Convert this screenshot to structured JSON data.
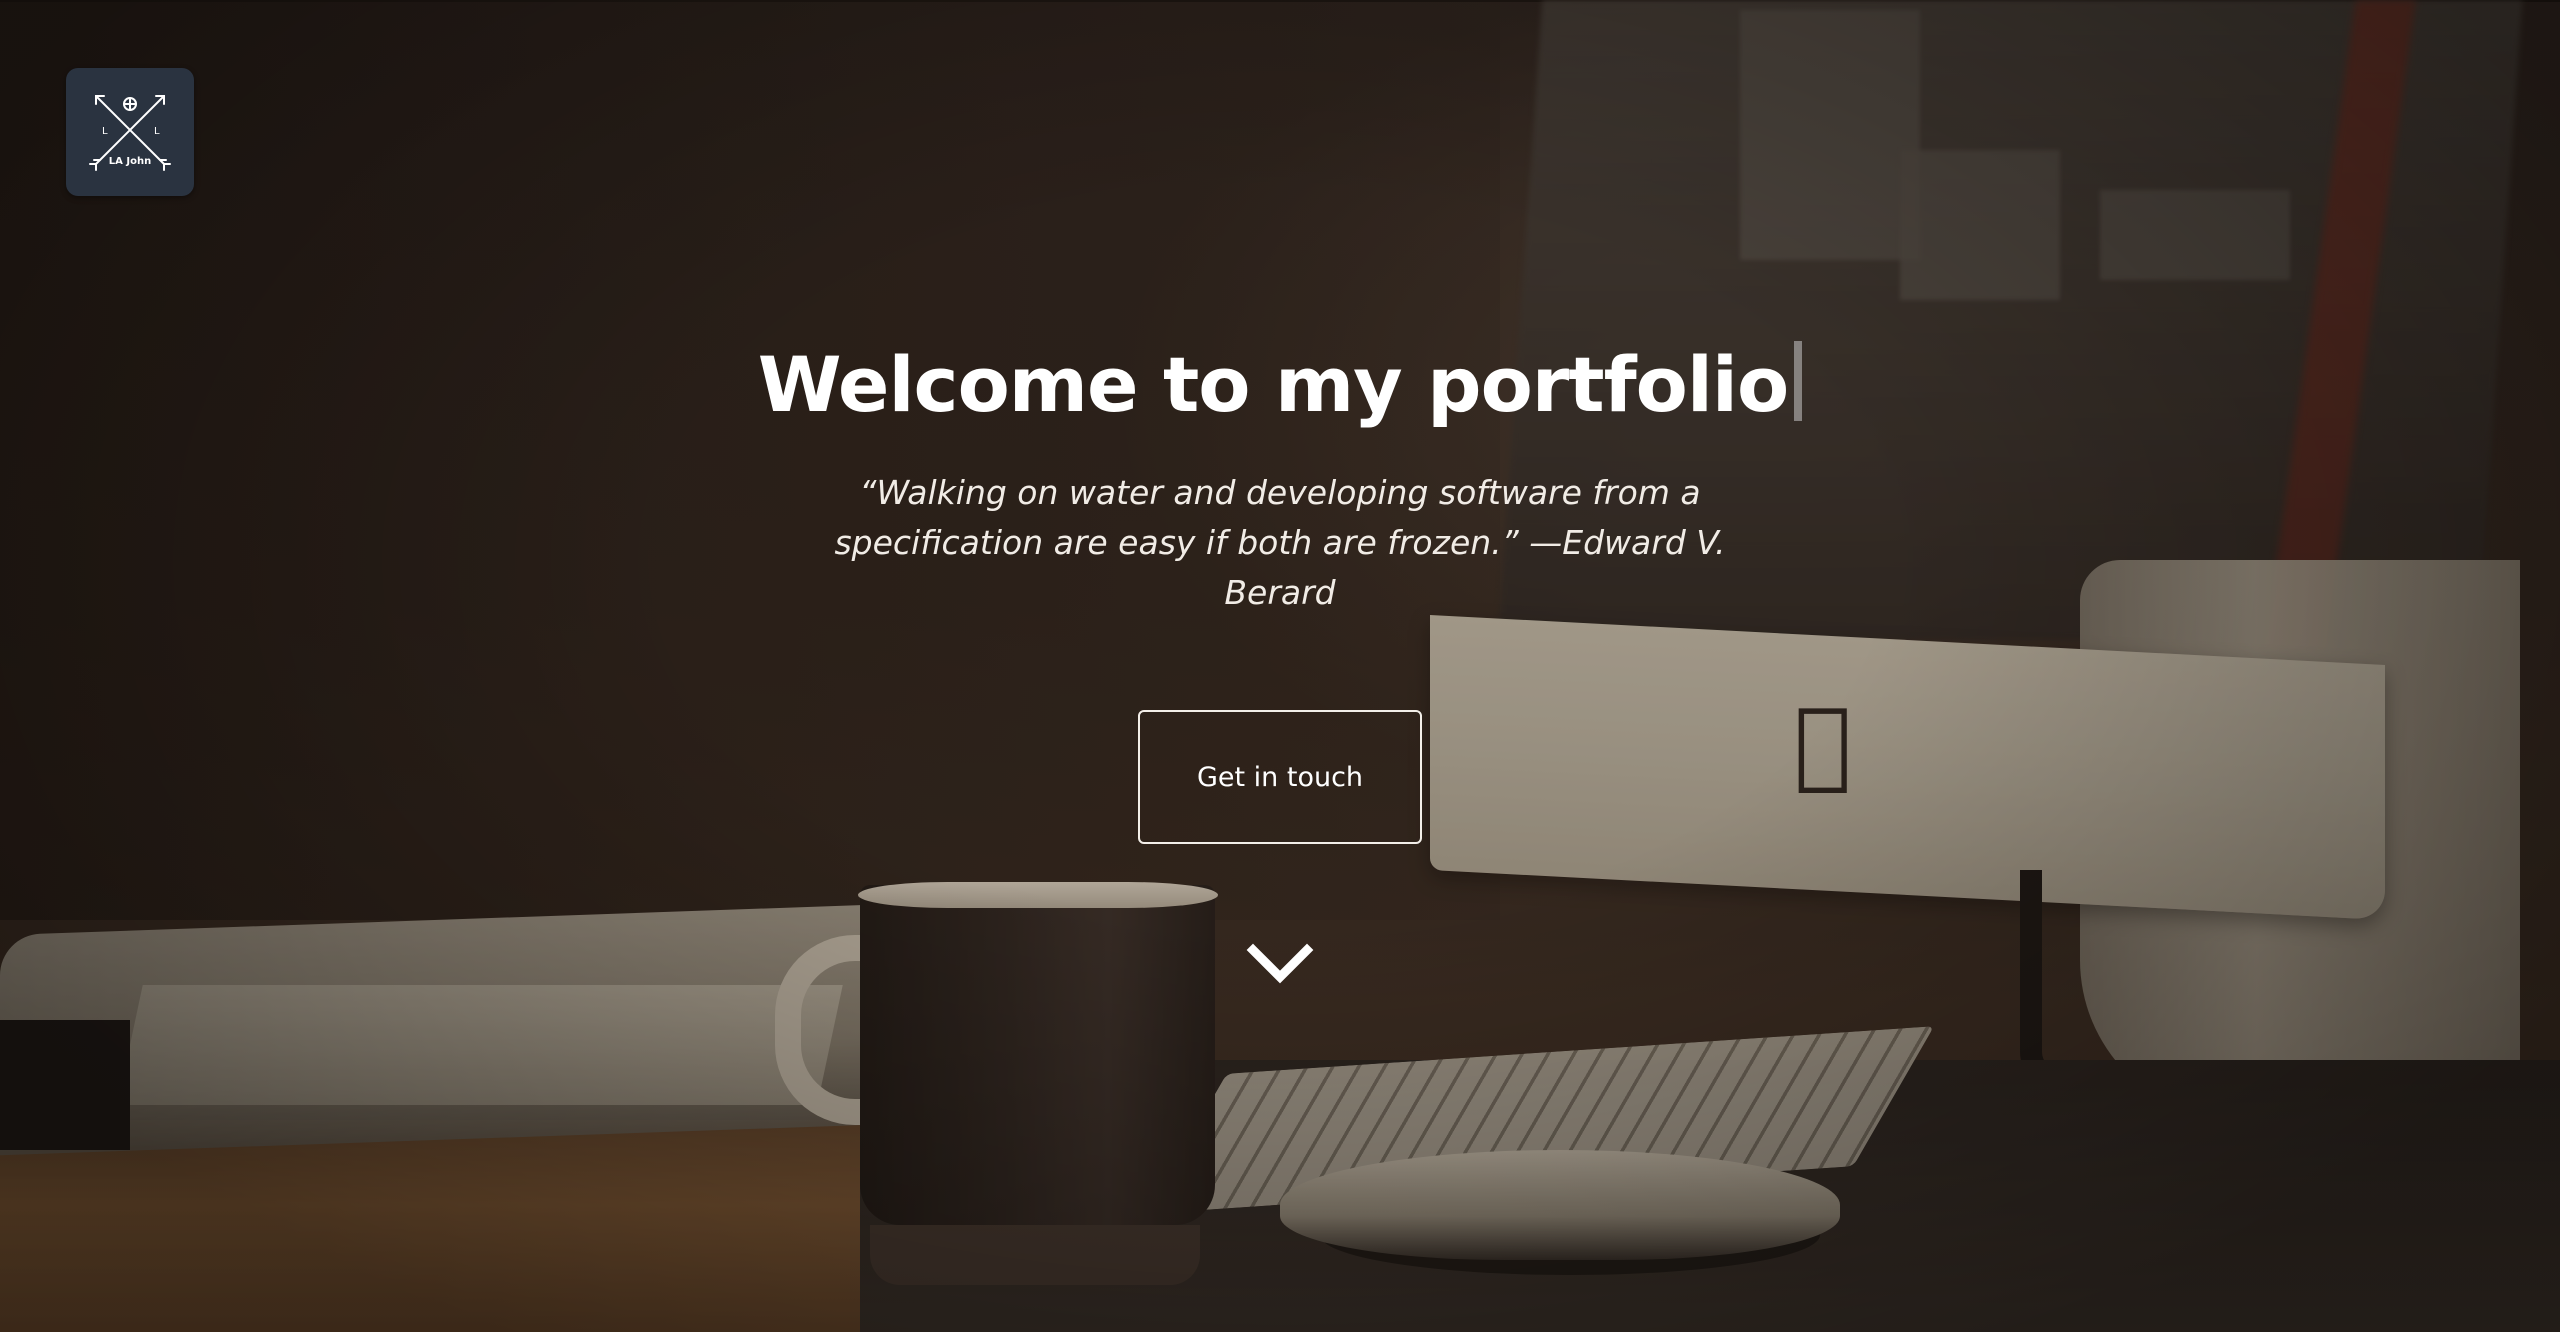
{
  "logo": {
    "text": "LA John",
    "side_letters": [
      "L",
      "L"
    ]
  },
  "hero": {
    "title": "Welcome to my portfolio",
    "quote": "“Walking on water and developing software from a specification are easy if both are frozen.” —Edward V. Berard",
    "cta_label": "Get in touch"
  },
  "icons": {
    "logo": "crossed-arrows-globe-icon",
    "scroll": "chevron-down-icon"
  },
  "colors": {
    "logo_bg": "#2a3340",
    "text": "#ffffff",
    "overlay": "#2b211c"
  }
}
